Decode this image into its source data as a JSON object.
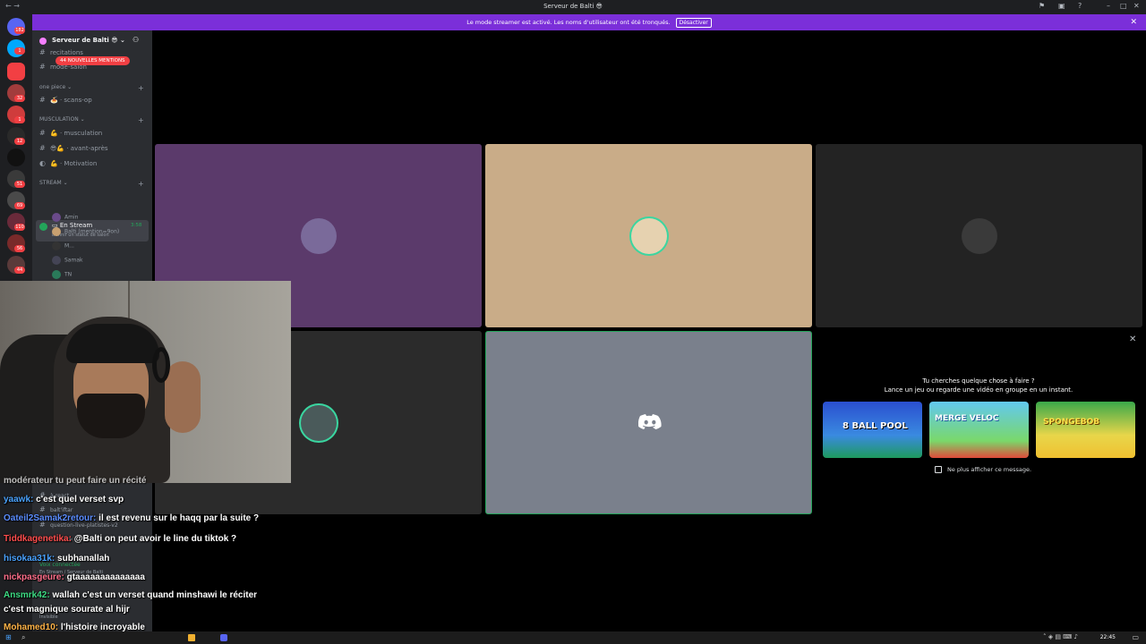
{
  "window": {
    "title": "Serveur de Balti 😎"
  },
  "banner": {
    "text": "Le mode streamer est activé. Les noms d'utilisateur ont été tronqués.",
    "button": "Désactiver"
  },
  "guild_badges": [
    "182",
    "1",
    "1",
    "32",
    "1",
    "12",
    "51",
    "69",
    "110",
    "56",
    "44"
  ],
  "server": {
    "name": "Serveur de Balti 😎"
  },
  "mentions_pill": "44 NOUVELLES MENTIONS",
  "channels_top": [
    "recitations",
    "mode-salon"
  ],
  "categories": {
    "one_piece": {
      "label": "one piece ⌄",
      "channels": [
        "scans-op"
      ]
    },
    "musculation": {
      "label": "MUSCULATION ⌄",
      "channels": [
        "musculation",
        "avant-après",
        "Motivation"
      ]
    },
    "stream": {
      "label": "STREAM ⌄"
    }
  },
  "voice": {
    "channel": "En Stream",
    "time": "3:58",
    "status": "Définir un statut de salon",
    "users": [
      "Amin",
      "Balti (mention=9on)",
      "M...",
      "Samak",
      "TN"
    ]
  },
  "promo": {
    "line1": "Tu cherches quelque chose à faire ?",
    "line2": "Lance un jeu ou regarde une vidéo en groupe en un instant.",
    "games": [
      "8 BALL POOL",
      "MERGE VELOC",
      "SPONGEBOB"
    ],
    "dont_show": "Ne plus afficher ce message."
  },
  "behind_chat": [
    "à-react",
    "balt'iftar",
    "question-live-platistes-v2",
    "Aucun partage",
    "Voix connectée",
    "En Stream / Serveur de Balti",
    "Invisible"
  ],
  "chat": [
    {
      "user": "modérateur",
      "msg": "tu peut faire un récité",
      "color": "#ffffff"
    },
    {
      "user": "yaawk:",
      "msg": "c'est quel verset svp",
      "color": "#4aa3ff"
    },
    {
      "user": "Oateil2Samak2retour:",
      "msg": "il est revenu sur le haqq par la suite ?",
      "color": "#5b8dff"
    },
    {
      "user": "Tiddkagenetika:",
      "msg": "@Balti on peut avoir le line du tiktok ?",
      "color": "#ff4d4d"
    },
    {
      "user": "hisokaa31k:",
      "msg": "subhanallah",
      "color": "#4aa3ff"
    },
    {
      "user": "nickpasgeure:",
      "msg": "gtaaaaaaaaaaaaaa",
      "color": "#ff6e8a"
    },
    {
      "user": "Ansmrk42:",
      "msg": "wallah c'est un verset quand minshawi le réciter",
      "color": "#3ddc84"
    },
    {
      "user": "c'est",
      "msg": "magnique sourate al hijr",
      "color": "#ffffff"
    },
    {
      "user": "Mohamed10:",
      "msg": "l'histoire incroyable",
      "color": "#ffb347"
    }
  ],
  "taskbar": {
    "time": "22:45"
  }
}
